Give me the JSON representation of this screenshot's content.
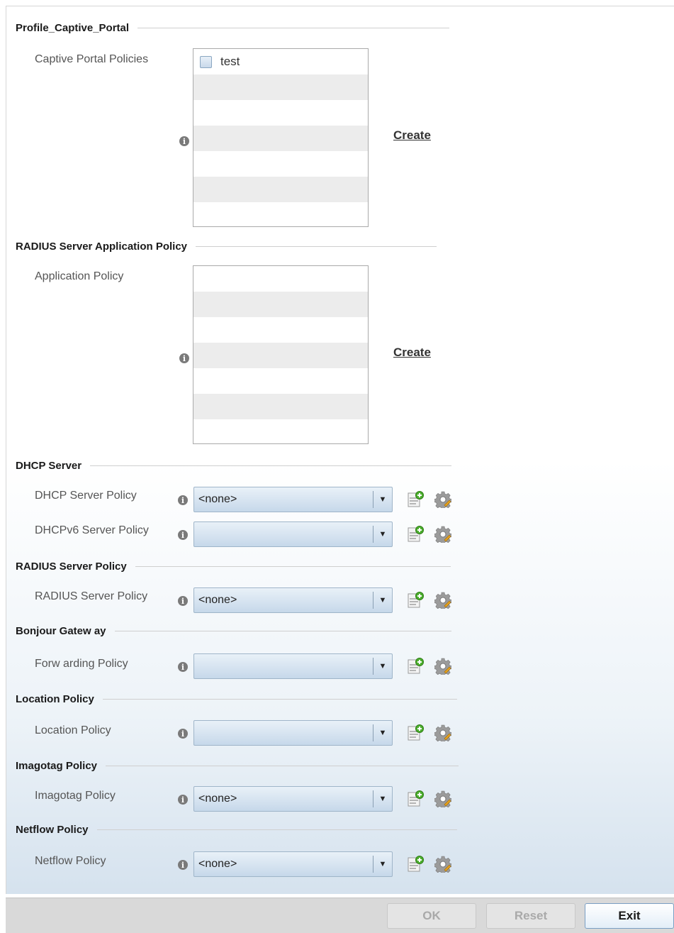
{
  "captive_portal": {
    "section_title": "Profile_Captive_Portal",
    "label": "Captive Portal Policies",
    "items": [
      "test"
    ],
    "create_label": "Create"
  },
  "radius_app": {
    "section_title": "RADIUS Server Application Policy",
    "label": "Application Policy",
    "create_label": "Create"
  },
  "dhcp": {
    "section_title": "DHCP Server",
    "server_label": "DHCP Server Policy",
    "server_value": "<none>",
    "v6_label": "DHCPv6 Server Policy",
    "v6_value": ""
  },
  "radius_server": {
    "section_title": "RADIUS Server Policy",
    "label": "RADIUS Server Policy",
    "value": "<none>"
  },
  "bonjour": {
    "section_title": "Bonjour Gatew ay",
    "label": "Forw arding Policy",
    "value": ""
  },
  "location": {
    "section_title": "Location Policy",
    "label": "Location Policy",
    "value": ""
  },
  "imagotag": {
    "section_title": "Imagotag Policy",
    "label": "Imagotag Policy",
    "value": "<none>"
  },
  "netflow": {
    "section_title": "Netflow Policy",
    "label": "Netflow Policy",
    "value": "<none>"
  },
  "footer": {
    "ok_label": "OK",
    "reset_label": "Reset",
    "exit_label": "Exit"
  },
  "icons": {
    "info": "info-icon",
    "add": "add-policy-icon",
    "edit": "gear-icon",
    "dropdown": "chevron-down-icon"
  }
}
